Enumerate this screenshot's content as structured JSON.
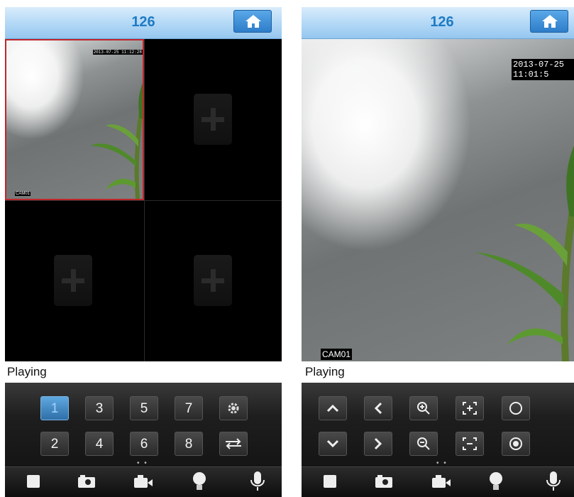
{
  "left": {
    "title": "126",
    "timestamp": "2013-07-25 11:12:28",
    "camera_label": "CAM01",
    "status": "Playing",
    "channel_keys": [
      "1",
      "3",
      "5",
      "7",
      "2",
      "4",
      "6",
      "8"
    ],
    "icons": [
      "settings-icon",
      "switch-icon"
    ],
    "page_dots": "• •"
  },
  "right": {
    "title": "126",
    "timestamp": "2013-07-25 11:01:5",
    "camera_label": "CAM01",
    "status": "Playing",
    "ptz_icons": [
      "up-icon",
      "left-icon",
      "zoom-in-icon",
      "focus-in-icon",
      "iris-open-icon",
      "down-icon",
      "right-icon",
      "zoom-out-icon",
      "focus-out-icon",
      "iris-close-icon"
    ],
    "page_dots": "• •"
  },
  "toolbar_icons": [
    "stop-icon",
    "snapshot-icon",
    "record-icon",
    "light-icon",
    "microphone-icon"
  ]
}
